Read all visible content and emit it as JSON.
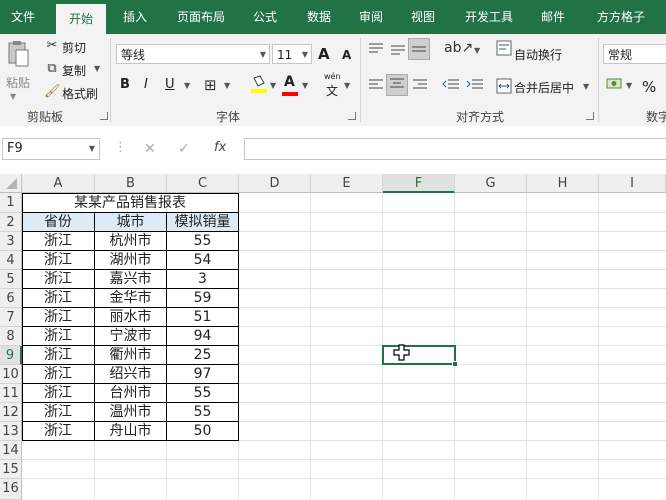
{
  "tabs": [
    "文件",
    "开始",
    "插入",
    "页面布局",
    "公式",
    "数据",
    "审阅",
    "视图",
    "开发工具",
    "邮件",
    "方方格子"
  ],
  "active_tab": "开始",
  "ribbon": {
    "clipboard": {
      "paste": "粘贴",
      "cut": "剪切",
      "copy": "复制",
      "format_painter": "格式刷",
      "label": "剪贴板"
    },
    "font": {
      "name": "等线",
      "size": "11",
      "bold": "B",
      "italic": "I",
      "underline": "U",
      "grow": "A",
      "shrink": "A",
      "color_glyph": "A",
      "wen": "wén",
      "wen_char": "文",
      "label": "字体"
    },
    "alignment": {
      "wrap": "自动换行",
      "merge": "合并后居中",
      "label": "对齐方式"
    },
    "number": {
      "format": "常规",
      "percent": "%",
      "label": "数字"
    }
  },
  "name_box": "F9",
  "formula_bar": {
    "cancel": "✕",
    "enter": "✓",
    "fx": "fx",
    "content": ""
  },
  "columns": [
    "A",
    "B",
    "C",
    "D",
    "E",
    "F",
    "G",
    "H",
    "I"
  ],
  "rows": [
    "1",
    "2",
    "3",
    "4",
    "5",
    "6",
    "7",
    "8",
    "9",
    "10",
    "11",
    "12",
    "13",
    "14",
    "15",
    "16"
  ],
  "selected_cell": "F9",
  "table": {
    "title": "某某产品销售报表",
    "headers": [
      "省份",
      "城市",
      "模拟销量"
    ],
    "rows": [
      [
        "浙江",
        "杭州市",
        "55"
      ],
      [
        "浙江",
        "湖州市",
        "54"
      ],
      [
        "浙江",
        "嘉兴市",
        "3"
      ],
      [
        "浙江",
        "金华市",
        "59"
      ],
      [
        "浙江",
        "丽水市",
        "51"
      ],
      [
        "浙江",
        "宁波市",
        "94"
      ],
      [
        "浙江",
        "衢州市",
        "25"
      ],
      [
        "浙江",
        "绍兴市",
        "97"
      ],
      [
        "浙江",
        "台州市",
        "55"
      ],
      [
        "浙江",
        "温州市",
        "55"
      ],
      [
        "浙江",
        "舟山市",
        "50"
      ]
    ]
  },
  "colors": {
    "excel_green": "#217346",
    "header_fill": "#ddebf7"
  }
}
